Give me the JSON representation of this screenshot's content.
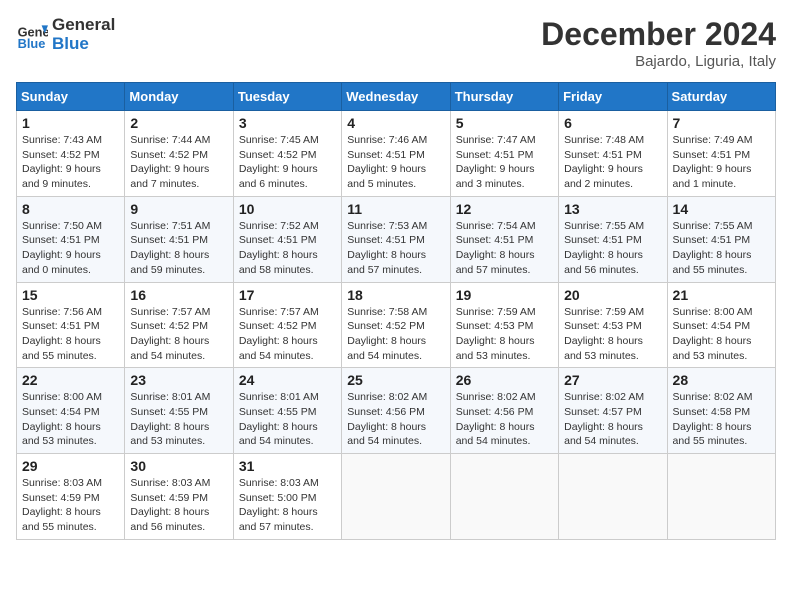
{
  "header": {
    "logo_line1": "General",
    "logo_line2": "Blue",
    "month_year": "December 2024",
    "location": "Bajardo, Liguria, Italy"
  },
  "weekdays": [
    "Sunday",
    "Monday",
    "Tuesday",
    "Wednesday",
    "Thursday",
    "Friday",
    "Saturday"
  ],
  "weeks": [
    [
      {
        "day": "1",
        "info": "Sunrise: 7:43 AM\nSunset: 4:52 PM\nDaylight: 9 hours and 9 minutes."
      },
      {
        "day": "2",
        "info": "Sunrise: 7:44 AM\nSunset: 4:52 PM\nDaylight: 9 hours and 7 minutes."
      },
      {
        "day": "3",
        "info": "Sunrise: 7:45 AM\nSunset: 4:52 PM\nDaylight: 9 hours and 6 minutes."
      },
      {
        "day": "4",
        "info": "Sunrise: 7:46 AM\nSunset: 4:51 PM\nDaylight: 9 hours and 5 minutes."
      },
      {
        "day": "5",
        "info": "Sunrise: 7:47 AM\nSunset: 4:51 PM\nDaylight: 9 hours and 3 minutes."
      },
      {
        "day": "6",
        "info": "Sunrise: 7:48 AM\nSunset: 4:51 PM\nDaylight: 9 hours and 2 minutes."
      },
      {
        "day": "7",
        "info": "Sunrise: 7:49 AM\nSunset: 4:51 PM\nDaylight: 9 hours and 1 minute."
      }
    ],
    [
      {
        "day": "8",
        "info": "Sunrise: 7:50 AM\nSunset: 4:51 PM\nDaylight: 9 hours and 0 minutes."
      },
      {
        "day": "9",
        "info": "Sunrise: 7:51 AM\nSunset: 4:51 PM\nDaylight: 8 hours and 59 minutes."
      },
      {
        "day": "10",
        "info": "Sunrise: 7:52 AM\nSunset: 4:51 PM\nDaylight: 8 hours and 58 minutes."
      },
      {
        "day": "11",
        "info": "Sunrise: 7:53 AM\nSunset: 4:51 PM\nDaylight: 8 hours and 57 minutes."
      },
      {
        "day": "12",
        "info": "Sunrise: 7:54 AM\nSunset: 4:51 PM\nDaylight: 8 hours and 57 minutes."
      },
      {
        "day": "13",
        "info": "Sunrise: 7:55 AM\nSunset: 4:51 PM\nDaylight: 8 hours and 56 minutes."
      },
      {
        "day": "14",
        "info": "Sunrise: 7:55 AM\nSunset: 4:51 PM\nDaylight: 8 hours and 55 minutes."
      }
    ],
    [
      {
        "day": "15",
        "info": "Sunrise: 7:56 AM\nSunset: 4:51 PM\nDaylight: 8 hours and 55 minutes."
      },
      {
        "day": "16",
        "info": "Sunrise: 7:57 AM\nSunset: 4:52 PM\nDaylight: 8 hours and 54 minutes."
      },
      {
        "day": "17",
        "info": "Sunrise: 7:57 AM\nSunset: 4:52 PM\nDaylight: 8 hours and 54 minutes."
      },
      {
        "day": "18",
        "info": "Sunrise: 7:58 AM\nSunset: 4:52 PM\nDaylight: 8 hours and 54 minutes."
      },
      {
        "day": "19",
        "info": "Sunrise: 7:59 AM\nSunset: 4:53 PM\nDaylight: 8 hours and 53 minutes."
      },
      {
        "day": "20",
        "info": "Sunrise: 7:59 AM\nSunset: 4:53 PM\nDaylight: 8 hours and 53 minutes."
      },
      {
        "day": "21",
        "info": "Sunrise: 8:00 AM\nSunset: 4:54 PM\nDaylight: 8 hours and 53 minutes."
      }
    ],
    [
      {
        "day": "22",
        "info": "Sunrise: 8:00 AM\nSunset: 4:54 PM\nDaylight: 8 hours and 53 minutes."
      },
      {
        "day": "23",
        "info": "Sunrise: 8:01 AM\nSunset: 4:55 PM\nDaylight: 8 hours and 53 minutes."
      },
      {
        "day": "24",
        "info": "Sunrise: 8:01 AM\nSunset: 4:55 PM\nDaylight: 8 hours and 54 minutes."
      },
      {
        "day": "25",
        "info": "Sunrise: 8:02 AM\nSunset: 4:56 PM\nDaylight: 8 hours and 54 minutes."
      },
      {
        "day": "26",
        "info": "Sunrise: 8:02 AM\nSunset: 4:56 PM\nDaylight: 8 hours and 54 minutes."
      },
      {
        "day": "27",
        "info": "Sunrise: 8:02 AM\nSunset: 4:57 PM\nDaylight: 8 hours and 54 minutes."
      },
      {
        "day": "28",
        "info": "Sunrise: 8:02 AM\nSunset: 4:58 PM\nDaylight: 8 hours and 55 minutes."
      }
    ],
    [
      {
        "day": "29",
        "info": "Sunrise: 8:03 AM\nSunset: 4:59 PM\nDaylight: 8 hours and 55 minutes."
      },
      {
        "day": "30",
        "info": "Sunrise: 8:03 AM\nSunset: 4:59 PM\nDaylight: 8 hours and 56 minutes."
      },
      {
        "day": "31",
        "info": "Sunrise: 8:03 AM\nSunset: 5:00 PM\nDaylight: 8 hours and 57 minutes."
      },
      null,
      null,
      null,
      null
    ]
  ]
}
